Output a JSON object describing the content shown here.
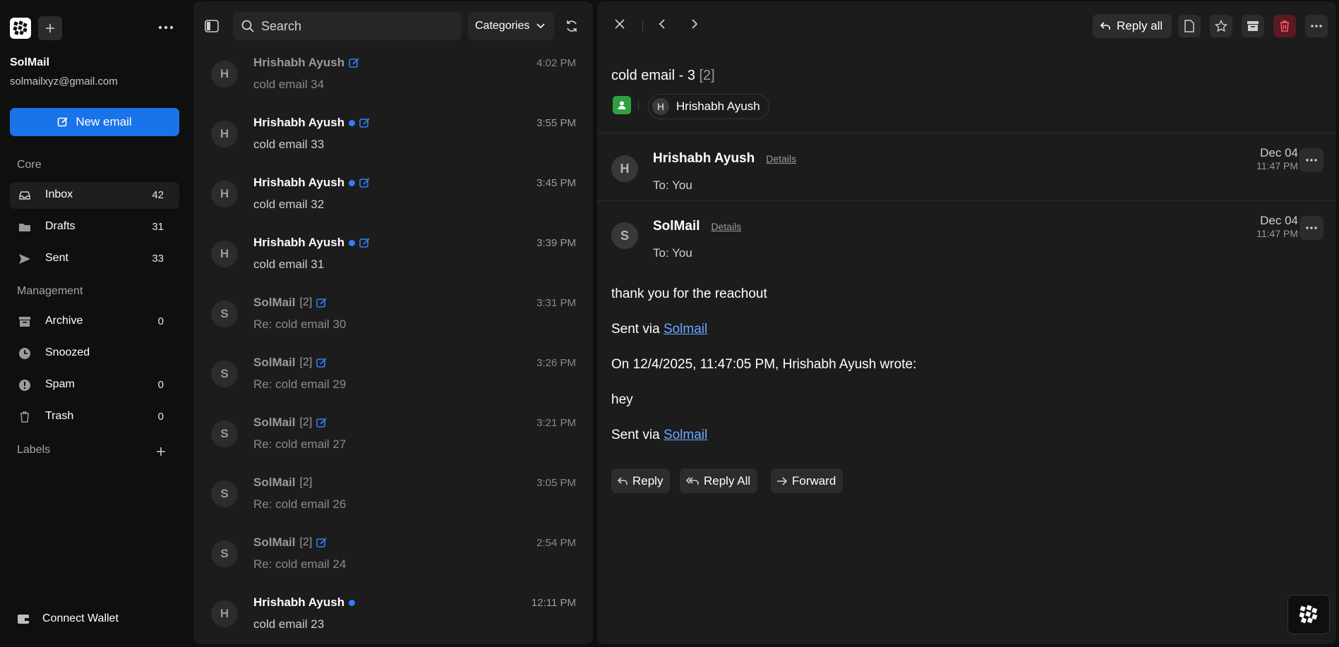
{
  "sidebar": {
    "account_name": "SolMail",
    "account_email": "solmailxyz@gmail.com",
    "new_email_label": "New email",
    "section_core": "Core",
    "section_management": "Management",
    "section_labels": "Labels",
    "items": [
      {
        "label": "Inbox",
        "count": "42",
        "icon": "inbox-icon"
      },
      {
        "label": "Drafts",
        "count": "31",
        "icon": "folder-icon"
      },
      {
        "label": "Sent",
        "count": "33",
        "icon": "send-icon"
      },
      {
        "label": "Archive",
        "count": "0",
        "icon": "archive-icon"
      },
      {
        "label": "Snoozed",
        "count": "",
        "icon": "clock-icon"
      },
      {
        "label": "Spam",
        "count": "0",
        "icon": "alert-icon"
      },
      {
        "label": "Trash",
        "count": "0",
        "icon": "trash-icon"
      }
    ],
    "connect_wallet_label": "Connect Wallet"
  },
  "mail_list": {
    "search_placeholder": "Search",
    "categories_label": "Categories",
    "rows": [
      {
        "avatar": "H",
        "sender": "Hrishabh Ayush",
        "count": "",
        "subject": "cold email 34",
        "time": "4:02 PM"
      },
      {
        "avatar": "H",
        "sender": "Hrishabh Ayush",
        "count": "",
        "subject": "cold email 33",
        "time": "3:55 PM"
      },
      {
        "avatar": "H",
        "sender": "Hrishabh Ayush",
        "count": "",
        "subject": "cold email 32",
        "time": "3:45 PM"
      },
      {
        "avatar": "H",
        "sender": "Hrishabh Ayush",
        "count": "",
        "subject": "cold email 31",
        "time": "3:39 PM"
      },
      {
        "avatar": "S",
        "sender": "SolMail",
        "count": "[2]",
        "subject": "Re: cold email 30",
        "time": "3:31 PM"
      },
      {
        "avatar": "S",
        "sender": "SolMail",
        "count": "[2]",
        "subject": "Re: cold email 29",
        "time": "3:26 PM"
      },
      {
        "avatar": "S",
        "sender": "SolMail",
        "count": "[2]",
        "subject": "Re: cold email 27",
        "time": "3:21 PM"
      },
      {
        "avatar": "S",
        "sender": "SolMail",
        "count": "[2]",
        "subject": "Re: cold email 26",
        "time": "3:05 PM"
      },
      {
        "avatar": "S",
        "sender": "SolMail",
        "count": "[2]",
        "subject": "Re: cold email 24",
        "time": "2:54 PM"
      },
      {
        "avatar": "H",
        "sender": "Hrishabh Ayush",
        "count": "",
        "subject": "cold email 23",
        "time": "12:11 PM"
      }
    ]
  },
  "detail": {
    "reply_all_label": "Reply all",
    "thread_title": "cold email - 3",
    "thread_count": "[2]",
    "participant_avatar": "H",
    "participant_name": "Hrishabh Ayush",
    "messages": [
      {
        "avatar": "H",
        "from": "Hrishabh Ayush",
        "details": "Details",
        "to": "To: You",
        "date": "Dec 04",
        "time": "11:47 PM"
      },
      {
        "avatar": "S",
        "from": "SolMail",
        "details": "Details",
        "to": "To: You",
        "date": "Dec 04",
        "time": "11:47 PM"
      }
    ],
    "body": {
      "line1": "thank you for the reachout",
      "sent_via": "Sent via",
      "link": "Solmail",
      "quote_header": "On 12/4/2025, 11:47:05 PM, Hrishabh Ayush wrote:",
      "quote_text": "hey"
    },
    "actions": {
      "reply": "Reply",
      "reply_all": "Reply All",
      "forward": "Forward"
    }
  },
  "colors": {
    "accent": "#1a73e8",
    "unread_dot": "#2f7ff5",
    "delete_bg": "#5b1a1f",
    "contact_green": "#2ea043"
  }
}
